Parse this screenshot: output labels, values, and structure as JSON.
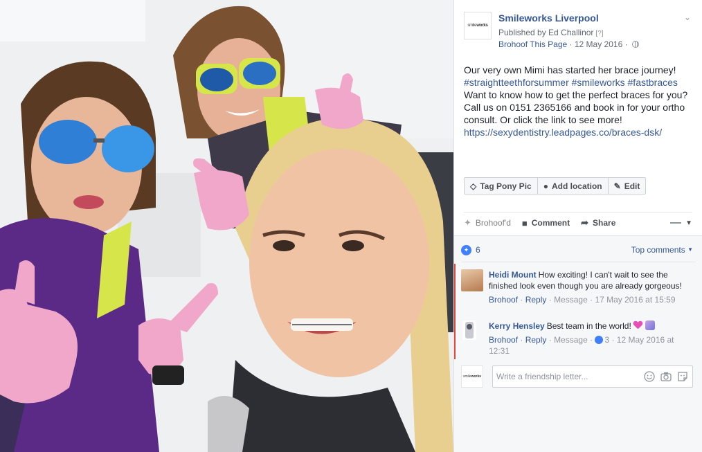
{
  "photo": {
    "alt_icon": "selfie-photo",
    "colors": {
      "glove": "#f0a7c9",
      "scrubs_purple": "#5b2a86",
      "lime": "#d6e64a",
      "lens_blue": "#2f7fd6"
    }
  },
  "post": {
    "page_name": "Smileworks Liverpool",
    "page_logo_text_a": "smile",
    "page_logo_text_b": "works",
    "published_by": "Published by Ed Challinor",
    "published_help": "[?]",
    "brohoof_page": "Brohoof This Page",
    "date": "12 May 2016",
    "text_line1": "Our very own Mimi has started her brace journey!",
    "hashtags": "#straightteethforsummer #smileworks #fastbraces",
    "text_body": "Want to know how to get the perfect braces for you? Call us on 0151 2365166 and book in for your ortho consult. Or click the link to see more!",
    "url": "https://sexydentistry.leadpages.co/braces-dsk/"
  },
  "tag_bar": {
    "tag": "Tag Pony Pic",
    "location": "Add location",
    "edit": "Edit"
  },
  "actions": {
    "brohoofd": "Brohoof'd",
    "comment": "Comment",
    "share": "Share"
  },
  "comments_panel": {
    "count": "6",
    "sort": "Top comments",
    "items": [
      {
        "author": "Heidi Mount",
        "text": "How exciting! I can't wait to see the finished look even though you are already gorgeous!",
        "brohoof": "Brohoof",
        "reply": "Reply",
        "message": "Message",
        "time": "17 May 2016 at 15:59"
      },
      {
        "author": "Kerry Hensley",
        "text": "Best team in the world!",
        "brohoof": "Brohoof",
        "reply": "Reply",
        "message": "Message",
        "reactions": "3",
        "time": "12 May 2016 at 12:31"
      }
    ],
    "write_placeholder": "Write a friendship letter..."
  },
  "colors": {
    "link": "#365899",
    "meta": "#616770",
    "accent_red": "#e24b3b",
    "reaction_blue": "#4080ff"
  }
}
